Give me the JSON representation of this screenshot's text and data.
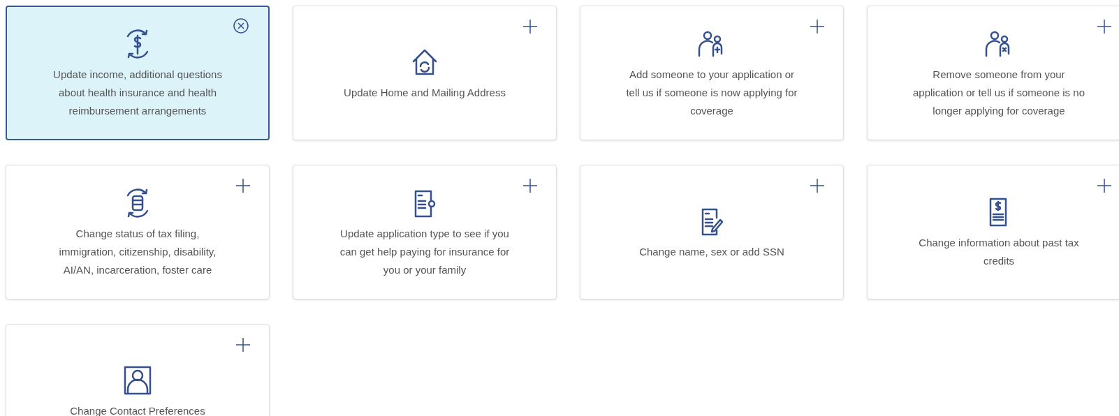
{
  "cards": [
    {
      "lines": [
        "Update income, additional questions",
        "about health insurance and health",
        "reimbursement arrangements"
      ],
      "selected": true
    },
    {
      "lines": [
        "Update Home and Mailing Address"
      ],
      "selected": false
    },
    {
      "lines": [
        "Add someone to your application or",
        "tell us if someone is now applying for",
        "coverage"
      ],
      "selected": false
    },
    {
      "lines": [
        "Remove someone from your",
        "application or tell us if someone is no",
        "longer applying for coverage"
      ],
      "selected": false
    },
    {
      "lines": [
        "Change status of tax filing,",
        "immigration, citizenship, disability,",
        "AI/AN, incarceration, foster care"
      ],
      "selected": false
    },
    {
      "lines": [
        "Update application type to see if you",
        "can get help paying for insurance for",
        "you or your family"
      ],
      "selected": false
    },
    {
      "lines": [
        "Change name, sex or add SSN"
      ],
      "selected": false
    },
    {
      "lines": [
        "Change information about past tax",
        "credits"
      ],
      "selected": false
    },
    {
      "lines": [
        "Change Contact Preferences"
      ],
      "selected": false
    }
  ]
}
